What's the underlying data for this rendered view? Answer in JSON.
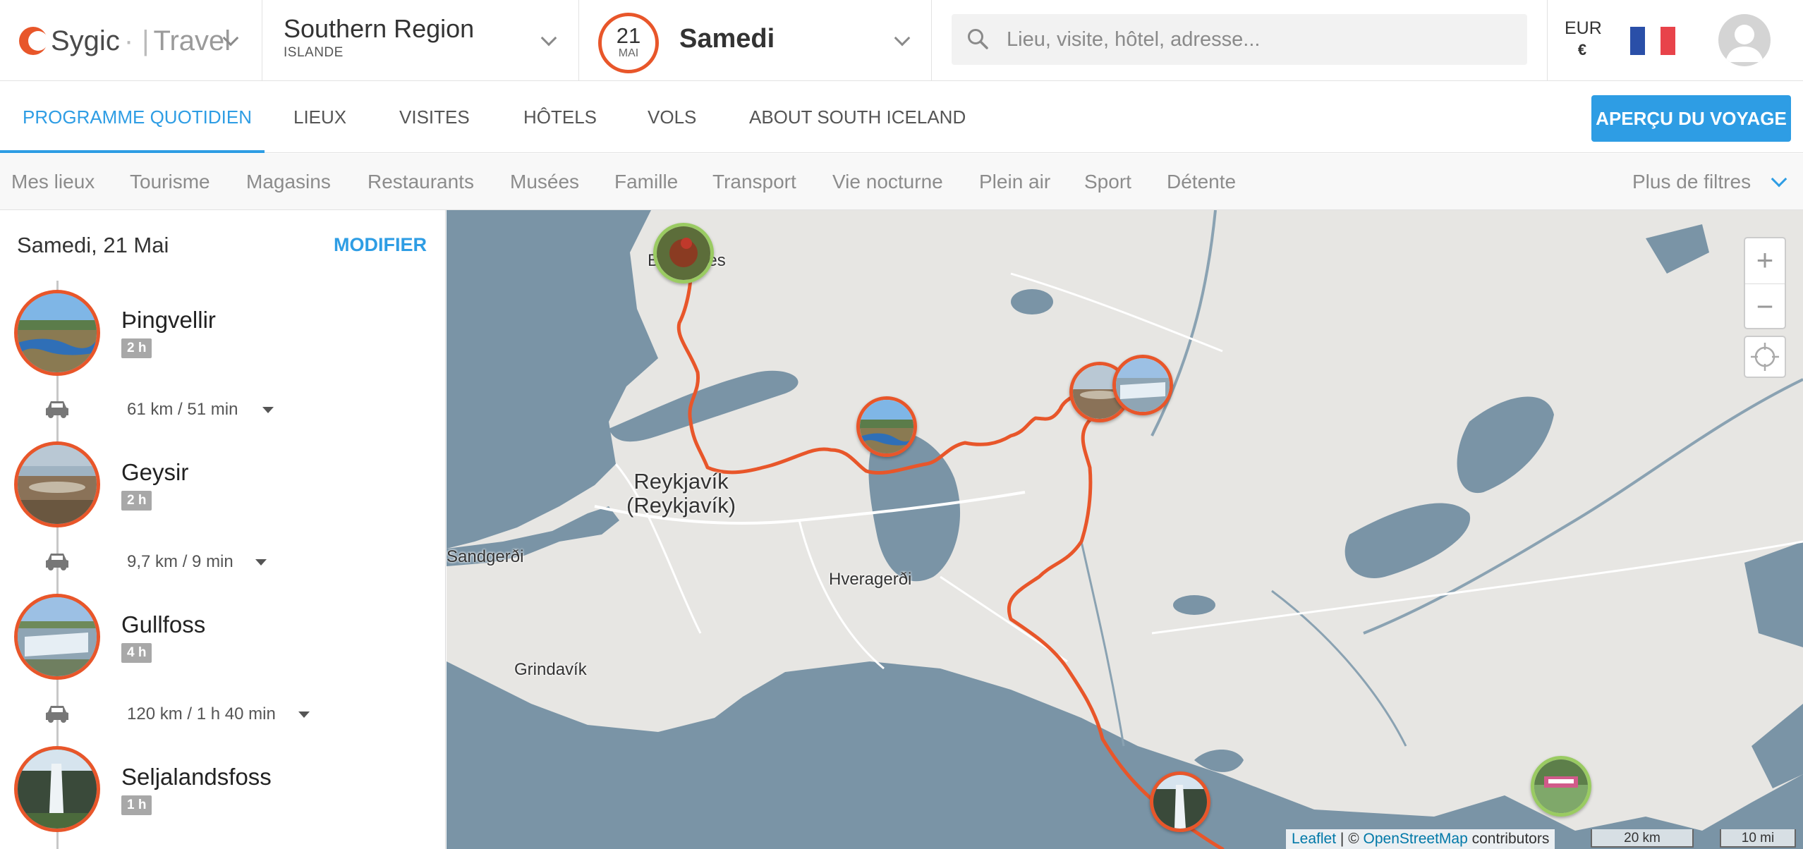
{
  "brand": {
    "name": "Sygic",
    "product": "Travel"
  },
  "region": {
    "name": "Southern Region",
    "country": "ISLANDE"
  },
  "date": {
    "day": "21",
    "month": "MAI",
    "weekday": "Samedi"
  },
  "search": {
    "placeholder": "Lieu, visite, hôtel, adresse..."
  },
  "currency": {
    "code": "EUR",
    "symbol": "€"
  },
  "tabs": [
    {
      "label": "PROGRAMME QUOTIDIEN",
      "active": true
    },
    {
      "label": "LIEUX"
    },
    {
      "label": "VISITES"
    },
    {
      "label": "HÔTELS"
    },
    {
      "label": "VOLS"
    },
    {
      "label": "ABOUT SOUTH ICELAND"
    }
  ],
  "cta": {
    "label": "APERÇU DU VOYAGE"
  },
  "filters": [
    "Mes lieux",
    "Tourisme",
    "Magasins",
    "Restaurants",
    "Musées",
    "Famille",
    "Transport",
    "Vie nocturne",
    "Plein air",
    "Sport",
    "Détente"
  ],
  "more_filters": "Plus de filtres",
  "itinerary": {
    "title": "Samedi, 21 Mai",
    "modify_label": "MODIFIER",
    "places": [
      {
        "name": "Þingvellir",
        "duration": "2 h"
      },
      {
        "name": "Geysir",
        "duration": "2 h"
      },
      {
        "name": "Gullfoss",
        "duration": "4 h"
      },
      {
        "name": "Seljalandsfoss",
        "duration": "1 h"
      }
    ],
    "routes": [
      {
        "distance": "61 km",
        "time": "51 min"
      },
      {
        "distance": "9,7 km",
        "time": "9 min"
      },
      {
        "distance": "120 km",
        "time": "1 h 40 min"
      }
    ]
  },
  "map": {
    "labels": {
      "reykjavik": "Reykjavík\n(Reykjavík)",
      "borgarnes": "Borgarnes",
      "sandgerdi": "Sandgerði",
      "hveragerdi": "Hveragerði",
      "grindavik": "Grindavík"
    },
    "attribution": {
      "leaflet": "Leaflet",
      "osm": "OpenStreetMap",
      "suffix": "contributors",
      "sep": "| ©"
    },
    "scale": {
      "metric": "20 km",
      "imperial": "10 mi"
    },
    "zoom_in": "+",
    "zoom_out": "−",
    "route_color": "#e8562a"
  },
  "colors": {
    "accent": "#2e9de4",
    "brand": "#e8562a",
    "water": "#7a94a6",
    "land": "#e7e6e3"
  }
}
